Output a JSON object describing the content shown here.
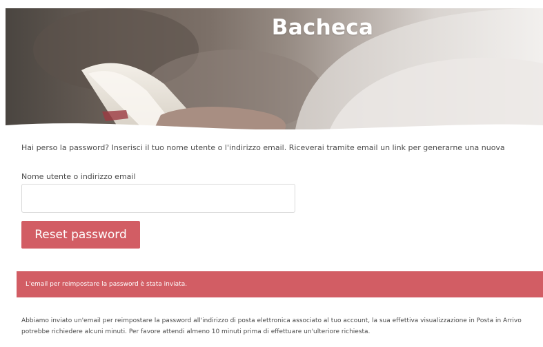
{
  "hero": {
    "title": "Bacheca"
  },
  "form": {
    "intro_text": "Hai perso la password? Inserisci il tuo nome utente o l'indirizzo email. Riceverai tramite email un link per generarne una nuova",
    "username_label": "Nome utente o indirizzo email",
    "username_value": "",
    "reset_button_label": "Reset password"
  },
  "notice": {
    "message": "L'email per reimpostare la password è stata inviata."
  },
  "info": {
    "message": "Abbiamo inviato un'email per reimpostare la password all'indirizzo di posta elettronica associato al tuo account, la sua effettiva visualizzazione in Posta in Arrivo potrebbe richiedere alcuni minuti. Per favore attendi almeno 10 minuti prima di effettuare un'ulteriore richiesta."
  },
  "colors": {
    "accent": "#d25d64",
    "text": "#4a4a4a",
    "input_border": "#d8d8d8"
  }
}
